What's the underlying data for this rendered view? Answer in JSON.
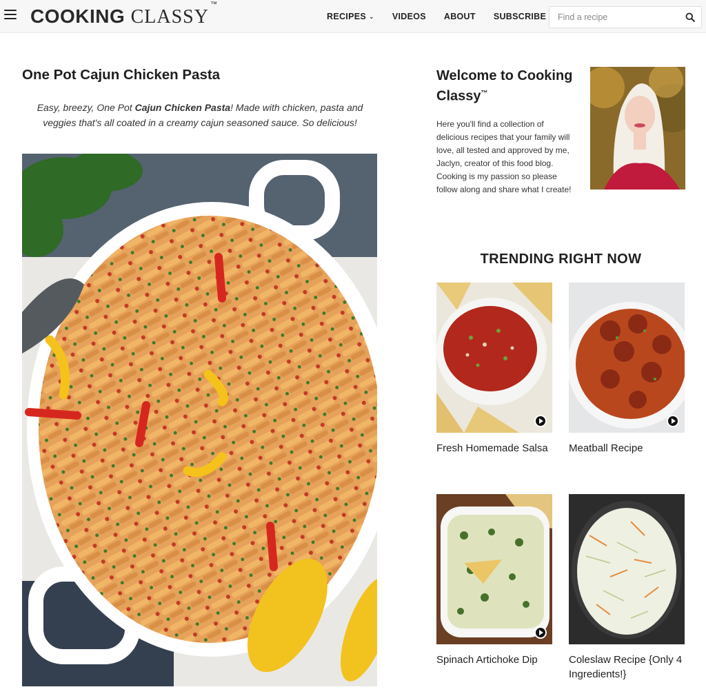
{
  "header": {
    "logo_word1": "COOKING",
    "logo_word2": "CLASSY",
    "logo_tm": "™",
    "nav": [
      {
        "label": "RECIPES"
      },
      {
        "label": "VIDEOS"
      },
      {
        "label": "ABOUT"
      },
      {
        "label": "SUBSCRIBE"
      }
    ],
    "search_placeholder": "Find a recipe"
  },
  "post": {
    "title": "One Pot Cajun Chicken Pasta",
    "intro_before": "Easy, breezy, One Pot ",
    "intro_bold": "Cajun Chicken Pasta",
    "intro_after": "! Made with chicken, pasta and veggies that's all coated in a creamy cajun seasoned sauce. So delicious!"
  },
  "sidebar": {
    "welcome_title": "Welcome to Cooking Classy",
    "welcome_tm": "™",
    "welcome_text": "Here you'll find a collection of delicious recipes that your family will love, all tested and approved by me, Jaclyn, creator of this food blog. Cooking is my passion so please follow along and share what I create!",
    "trending_title": "TRENDING RIGHT NOW",
    "trending": [
      {
        "title": "Fresh Homemade Salsa",
        "video": true
      },
      {
        "title": "Meatball Recipe",
        "video": true
      },
      {
        "title": "Spinach Artichoke Dip",
        "video": true
      },
      {
        "title": "Coleslaw Recipe {Only 4 Ingredients!}",
        "video": false
      }
    ]
  },
  "colors": {
    "header_bg": "#f7f7f7",
    "text": "#1f1f1f",
    "accent_red": "#c8102e"
  }
}
